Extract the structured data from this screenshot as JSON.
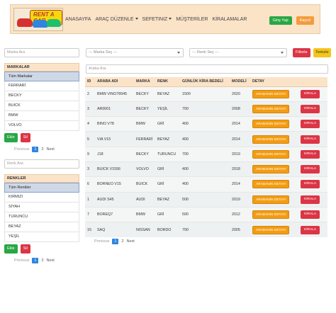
{
  "nav": {
    "logo_text": "RENT A CAR",
    "links": [
      "ANASAYFA",
      "ARAÇ DÜZENLE",
      "SEFETINIZ",
      "MÜŞTERİLER",
      "KİRALAMALAR"
    ],
    "login": "Giriş Yap",
    "register": "Kayıol"
  },
  "brands": {
    "search_placeholder": "Marka Ara",
    "header": "MARKALAR",
    "all": "Tüm Markalar",
    "items": [
      "FERRARİ",
      "BECKY",
      "BUICK",
      "BMW",
      "VOLVO"
    ],
    "add": "Ekle",
    "delete": "Sil",
    "pager": {
      "prev": "Previous",
      "pages": [
        "1",
        "2"
      ],
      "next": "Next"
    }
  },
  "colors_panel": {
    "search_placeholder": "Renk Ara",
    "header": "RENKLER",
    "all": "Tüm Renkler",
    "items": [
      "KIRMIZI",
      "SİYAH",
      "TURUNCU",
      "BEYAZ",
      "YEŞİL"
    ],
    "add": "Ekle",
    "delete": "Sil",
    "pager": {
      "prev": "Previous",
      "pages": [
        "1",
        "2"
      ],
      "next": "Next"
    }
  },
  "filters": {
    "brand_select": "--- Marka Seç ---",
    "color_select": "--- Renk Seç ---",
    "filter_btn": "Filtrele",
    "clear_btn": "Temizle",
    "car_search_placeholder": "Araba Ara"
  },
  "table": {
    "headers": [
      "ID",
      "ARABA ADI",
      "MARKA",
      "RENK",
      "GÜNLÜK KİRA BEDELİ",
      "MODELİ",
      "DETAY",
      ""
    ],
    "detail_label": "ARABANIN DETAYI",
    "rent_label": "KİRALA",
    "rows": [
      [
        "2",
        "BMW VINO78945",
        "BECKY",
        "BEYAZ",
        "1500",
        "2020"
      ],
      [
        "3",
        "AR0001",
        "BECKY",
        "YEŞİL",
        "700",
        "2008"
      ],
      [
        "4",
        "BINO V78",
        "BMW",
        "GRİ",
        "400",
        "2014"
      ],
      [
        "5",
        "VIA V15",
        "FERRARİ",
        "BEYAZ",
        "400",
        "2014"
      ],
      [
        "9",
        "J18",
        "BECKY",
        "TURUNCU",
        "700",
        "2019"
      ],
      [
        "3",
        "BUICK V1556",
        "VOLVO",
        "GRİ",
        "400",
        "2018"
      ],
      [
        "6",
        "BORNEO V15",
        "BUICK",
        "GRİ",
        "400",
        "2014"
      ],
      [
        "1",
        "AUDI S45",
        "AUDI",
        "BEYAZ",
        "500",
        "2019"
      ],
      [
        "7",
        "BOREQ7",
        "BMW",
        "GRİ",
        "500",
        "2012"
      ],
      [
        "15",
        "SAQ",
        "NISSAN",
        "BORDO",
        "700",
        "2005"
      ]
    ],
    "pager": {
      "prev": "Previous",
      "pages": [
        "1",
        "2"
      ],
      "next": "Next"
    }
  }
}
